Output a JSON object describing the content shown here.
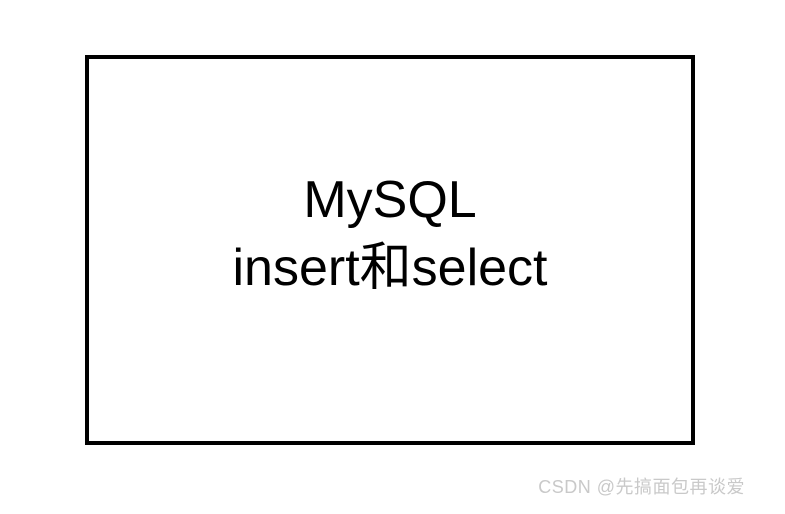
{
  "content": {
    "line1": "MySQL",
    "line2": "insert和select"
  },
  "watermark": "CSDN @先搞面包再谈爱"
}
